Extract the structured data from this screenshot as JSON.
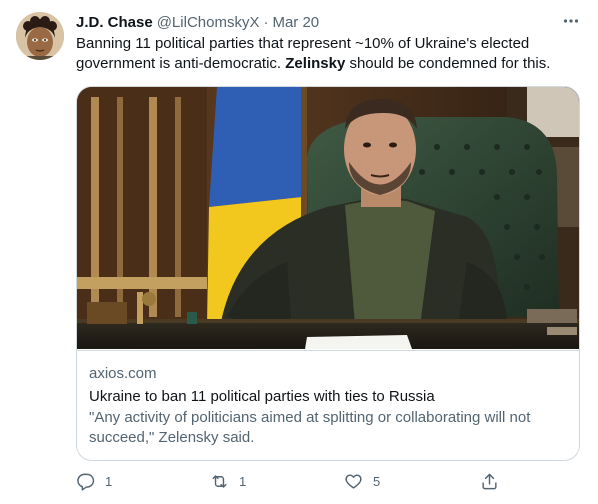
{
  "tweet": {
    "author_name": "J.D. Chase",
    "author_handle": "@LilChomskyX",
    "separator": "·",
    "timestamp": "Mar 20",
    "text_before": "Banning 11 political parties that represent ~10% of Ukraine's elected government is anti-democratic. ",
    "text_bold": "Zelinsky",
    "text_after": " should be condemned for this."
  },
  "card": {
    "domain": "axios.com",
    "title": "Ukraine to ban 11 political parties with ties to Russia",
    "description": "\"Any activity of politicians aimed at splitting or collaborating will not succeed,\" Zelensky said."
  },
  "actions": {
    "reply_count": "1",
    "retweet_count": "1",
    "like_count": "5"
  },
  "icons": {
    "more": "more-horizontal-icon",
    "reply": "reply-icon",
    "retweet": "retweet-icon",
    "like": "heart-icon",
    "share": "share-icon"
  },
  "colors": {
    "text_primary": "#0f1419",
    "text_secondary": "#536471",
    "border": "#cfd9de"
  }
}
